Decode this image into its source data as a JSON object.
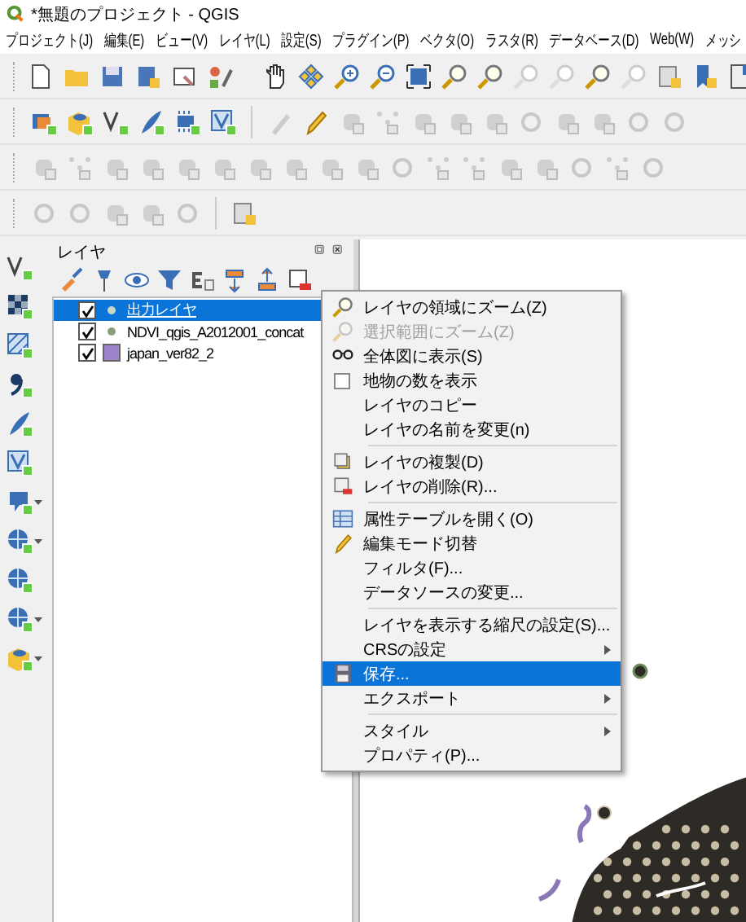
{
  "window": {
    "title": "*無題のプロジェクト - QGIS"
  },
  "menu_bar": [
    "プロジェクト(J)",
    "編集(E)",
    "ビュー(V)",
    "レイヤ(L)",
    "設定(S)",
    "プラグイン(P)",
    "ベクタ(O)",
    "ラスタ(R)",
    "データベース(D)",
    "Web(W)",
    "メッシ"
  ],
  "layers_panel": {
    "title": "レイヤ",
    "layers": [
      {
        "name": "出力レイヤ",
        "kind": "point",
        "checked": true,
        "selected": true
      },
      {
        "name": "NDVI_qgis_A2012001_concat",
        "kind": "point",
        "checked": true,
        "selected": false
      },
      {
        "name": "japan_ver82_2",
        "kind": "polygon",
        "checked": true,
        "selected": false,
        "color": "#9d83c9"
      }
    ]
  },
  "context_menu": {
    "groups": [
      [
        {
          "label": "レイヤの領域にズーム(Z)",
          "kind": "zoom",
          "disabled": false,
          "selected": false,
          "submenu": false
        },
        {
          "label": "選択範囲にズーム(Z)",
          "kind": "zoom",
          "disabled": true,
          "selected": false,
          "submenu": false
        },
        {
          "label": "全体図に表示(S)",
          "kind": "overview",
          "disabled": false,
          "selected": false,
          "submenu": false
        },
        {
          "label": "地物の数を表示",
          "kind": "checkbox",
          "checked": false,
          "disabled": false,
          "selected": false,
          "submenu": false
        },
        {
          "label": "レイヤのコピー",
          "kind": "plain",
          "disabled": false,
          "selected": false,
          "submenu": false
        },
        {
          "label": "レイヤの名前を変更(n)",
          "kind": "plain",
          "disabled": false,
          "selected": false,
          "submenu": false
        }
      ],
      [
        {
          "label": "レイヤの複製(D)",
          "kind": "duplicate",
          "disabled": false,
          "selected": false,
          "submenu": false
        },
        {
          "label": "レイヤの削除(R)...",
          "kind": "remove",
          "disabled": false,
          "selected": false,
          "submenu": false
        }
      ],
      [
        {
          "label": "属性テーブルを開く(O)",
          "kind": "table",
          "disabled": false,
          "selected": false,
          "submenu": false
        },
        {
          "label": "編集モード切替",
          "kind": "pencil",
          "disabled": false,
          "selected": false,
          "submenu": false
        },
        {
          "label": "フィルタ(F)...",
          "kind": "plain",
          "disabled": false,
          "selected": false,
          "submenu": false
        },
        {
          "label": "データソースの変更...",
          "kind": "plain",
          "disabled": false,
          "selected": false,
          "submenu": false
        }
      ],
      [
        {
          "label": "レイヤを表示する縮尺の設定(S)...",
          "kind": "plain",
          "disabled": false,
          "selected": false,
          "submenu": false
        },
        {
          "label": "CRSの設定",
          "kind": "plain",
          "disabled": false,
          "selected": false,
          "submenu": true
        },
        {
          "label": "保存...",
          "kind": "save",
          "disabled": false,
          "selected": true,
          "submenu": false
        },
        {
          "label": "エクスポート",
          "kind": "plain",
          "disabled": false,
          "selected": false,
          "submenu": true
        }
      ],
      [
        {
          "label": "スタイル",
          "kind": "plain",
          "disabled": false,
          "selected": false,
          "submenu": true
        },
        {
          "label": "プロパティ(P)...",
          "kind": "plain",
          "disabled": false,
          "selected": false,
          "submenu": false
        }
      ]
    ]
  }
}
